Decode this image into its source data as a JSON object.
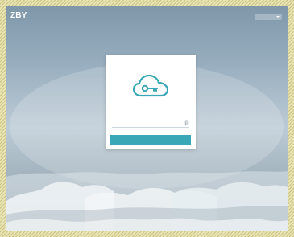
{
  "header": {
    "brand": "ZBY",
    "language_label": ""
  },
  "login_card": {
    "title": "",
    "icon": "cloud-key-icon",
    "password_field": {
      "placeholder": "",
      "value": ""
    },
    "show_password_icon": "eye-icon",
    "submit_label": ""
  },
  "footer_hint": {
    "text": "",
    "link_text": ""
  },
  "colors": {
    "accent": "#3aa7b6",
    "link": "#4bb2dc",
    "card_background": "#ffffff"
  }
}
